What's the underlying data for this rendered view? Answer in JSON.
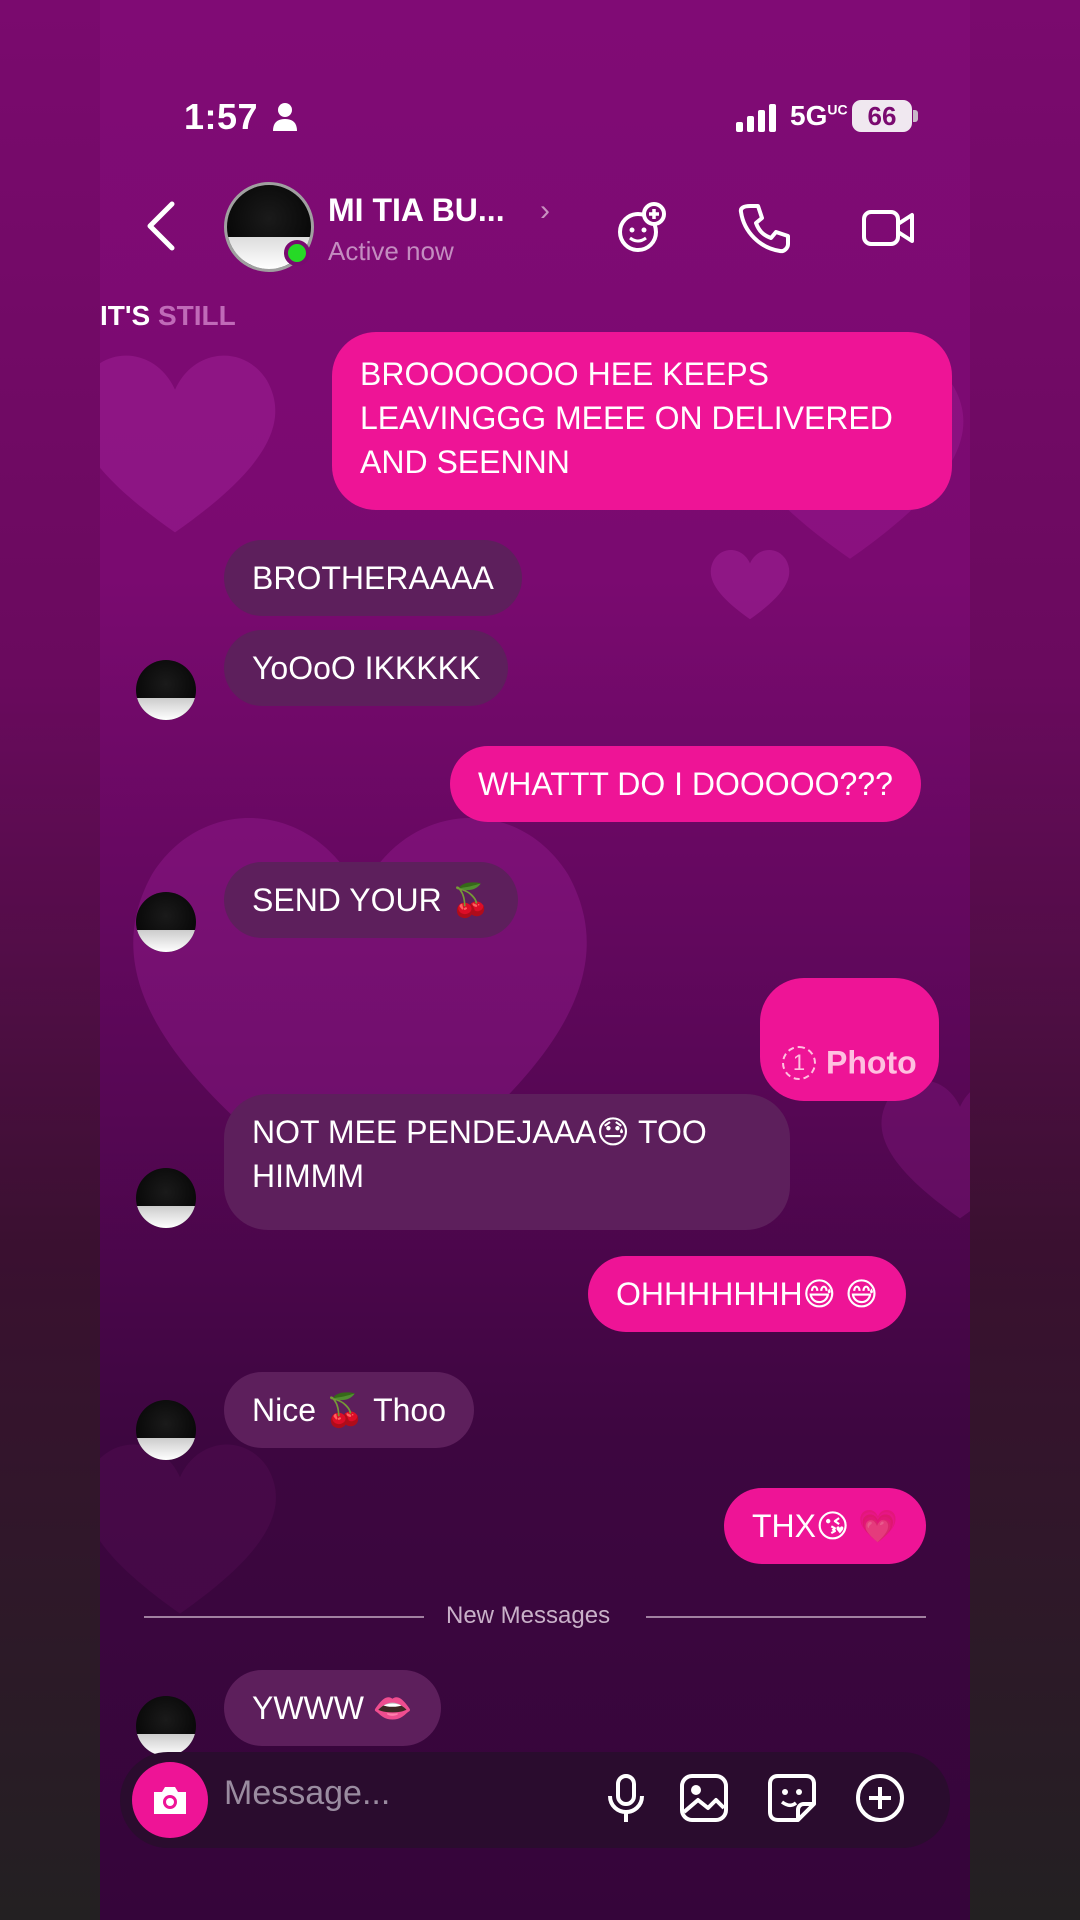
{
  "status_bar": {
    "time": "1:57",
    "network": "5G",
    "network_sup": "UC",
    "battery": "66"
  },
  "header": {
    "contact_name": "MI TIA BU...",
    "status": "Active now"
  },
  "banner": {
    "part1": "IT'S",
    "part2": "STILL"
  },
  "messages": [
    {
      "side": "sent",
      "text": "BROOOOOOO HEE KEEPS\nLEAVINGGG MEEE ON DELIVERED\nAND SEENNN"
    },
    {
      "side": "recv",
      "text": "BROTHERAAAA"
    },
    {
      "side": "recv",
      "text": "YoOoO IKKKKK"
    },
    {
      "side": "sent",
      "text": "WHATTT DO I DOOOOO???"
    },
    {
      "side": "recv",
      "text": "SEND YOUR 🍒"
    },
    {
      "side": "sent",
      "text": "Photo",
      "icon_label": "1"
    },
    {
      "side": "recv",
      "text": "NOT MEE PENDEJAAA😓 TOO\nHIMMM"
    },
    {
      "side": "sent",
      "text": "OHHHHHHH😅 😅"
    },
    {
      "side": "recv",
      "text": "Nice 🍒 Thoo"
    },
    {
      "side": "sent",
      "text": "THX😘 💗"
    },
    {
      "side": "recv",
      "text": "YWWW 👄"
    }
  ],
  "divider_label": "New Messages",
  "composer": {
    "placeholder": "Message..."
  },
  "colors": {
    "sent_bubble": "#ee1496",
    "recv_bubble": "#5d1f5c",
    "online": "#26d926"
  }
}
